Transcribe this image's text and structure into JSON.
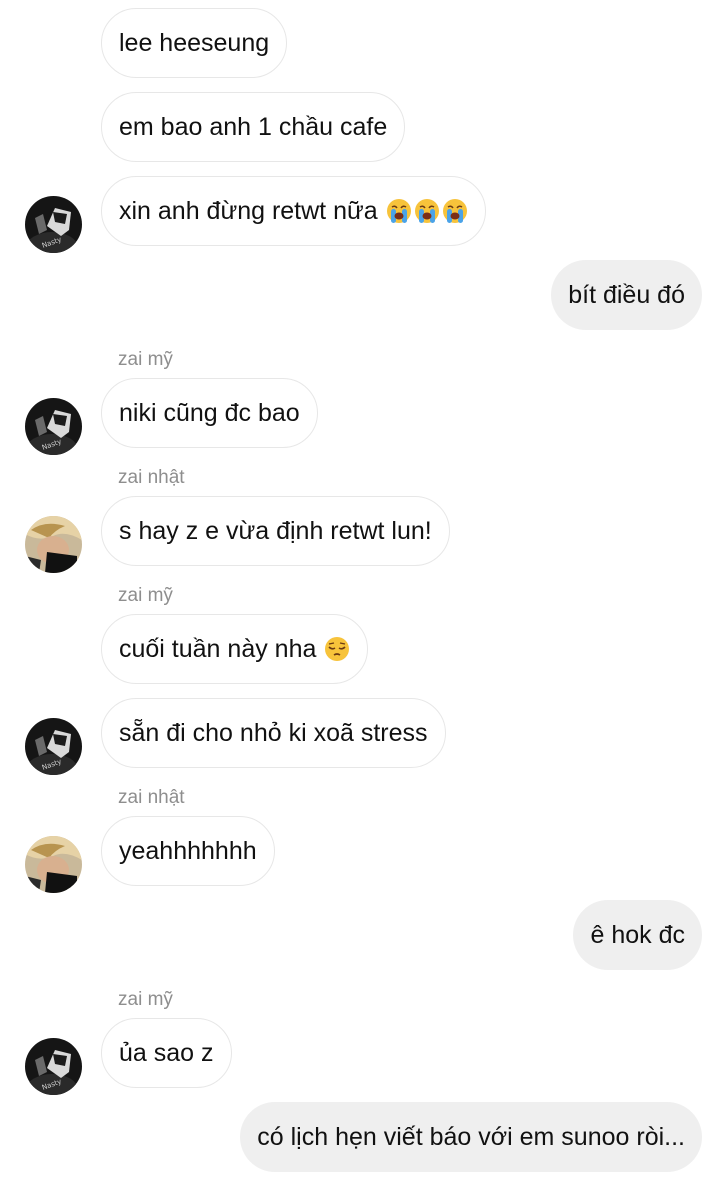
{
  "messages": [
    {
      "id": "m1",
      "dir": "in",
      "text": "lee heeseung"
    },
    {
      "id": "m2",
      "dir": "in",
      "text": "em bao anh 1 chầu cafe"
    },
    {
      "id": "m3",
      "dir": "in",
      "text": "xin anh đừng retwt nữa",
      "emoji": [
        "loudly-crying-face",
        "loudly-crying-face",
        "loudly-crying-face"
      ],
      "avatar": "dark-hat-avatar"
    },
    {
      "id": "m4",
      "dir": "out",
      "text": "bít điều đó"
    },
    {
      "id": "m5",
      "dir": "in",
      "sender": "zai mỹ",
      "text": "niki cũng đc bao",
      "avatar": "dark-hat-avatar"
    },
    {
      "id": "m6",
      "dir": "in",
      "sender": "zai nhật",
      "text": "s hay z e vừa định retwt lun!",
      "avatar": "blond-hair-avatar"
    },
    {
      "id": "m7",
      "dir": "in",
      "sender": "zai mỹ",
      "text": "cuối tuần này nha",
      "emoji": [
        "pensive-face"
      ]
    },
    {
      "id": "m8",
      "dir": "in",
      "text": "sẵn đi cho nhỏ ki xoã stress",
      "avatar": "dark-hat-avatar"
    },
    {
      "id": "m9",
      "dir": "in",
      "sender": "zai nhật",
      "text": "yeahhhhhhh",
      "avatar": "blond-hair-avatar"
    },
    {
      "id": "m10",
      "dir": "out",
      "text": "ê hok đc"
    },
    {
      "id": "m11",
      "dir": "in",
      "sender": "zai mỹ",
      "text": "ủa sao z",
      "avatar": "dark-hat-avatar"
    },
    {
      "id": "m12",
      "dir": "out",
      "text": "có lịch hẹn viết báo với em sunoo ròi..."
    }
  ]
}
